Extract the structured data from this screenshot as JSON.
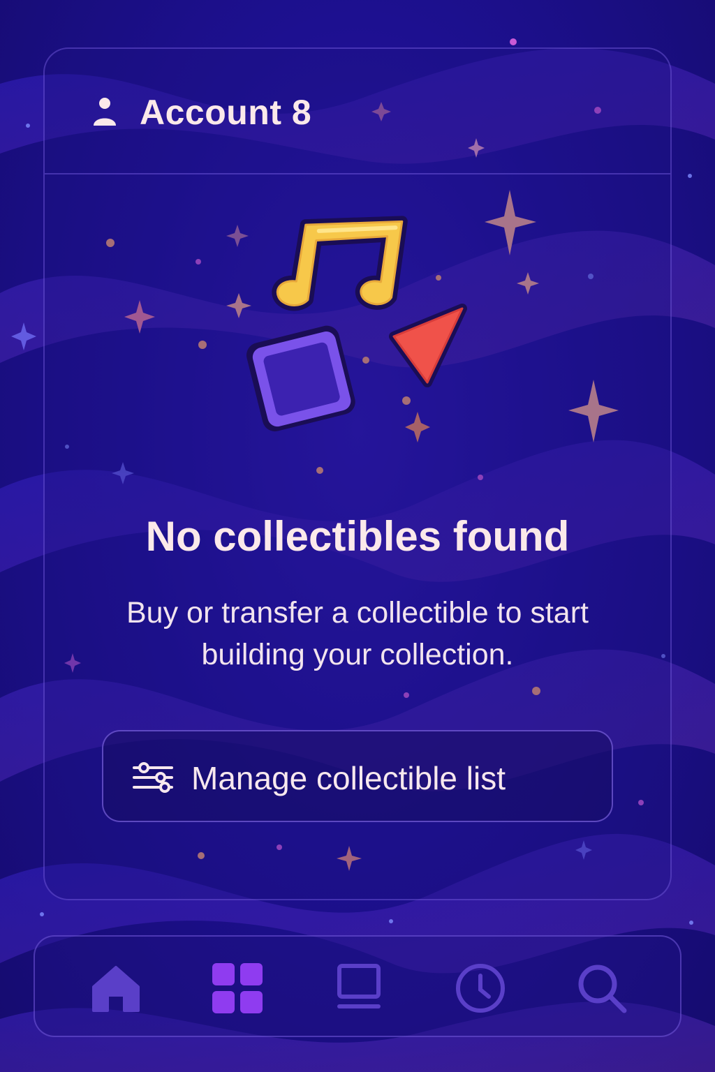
{
  "header": {
    "account_name": "Account 8",
    "icon": "person-icon"
  },
  "empty_state": {
    "title": "No collectibles found",
    "description": "Buy or transfer a collectible to start building your collection.",
    "illustration_icons": [
      "music-note-icon",
      "square-shape-icon",
      "triangle-shape-icon",
      "sparkle-icon"
    ]
  },
  "manage_button": {
    "label": "Manage collectible list",
    "icon": "sliders-icon"
  },
  "tab_bar": {
    "tabs": [
      {
        "id": "home",
        "icon": "home-icon",
        "active": false
      },
      {
        "id": "collectibles",
        "icon": "grid-icon",
        "active": true
      },
      {
        "id": "activity-screen",
        "icon": "laptop-icon",
        "active": false
      },
      {
        "id": "history",
        "icon": "clock-icon",
        "active": false
      },
      {
        "id": "search",
        "icon": "search-icon",
        "active": false
      }
    ]
  },
  "colors": {
    "background": "#1d1090",
    "text_primary": "#fbe9ea",
    "tab_inactive": "#5a3fc8",
    "tab_active": "#8f3cf0",
    "note_yellow": "#f7c84a",
    "square_purple": "#6d4ae6",
    "triangle_red": "#f0524a",
    "sparkle_peach": "#f3a98f"
  }
}
